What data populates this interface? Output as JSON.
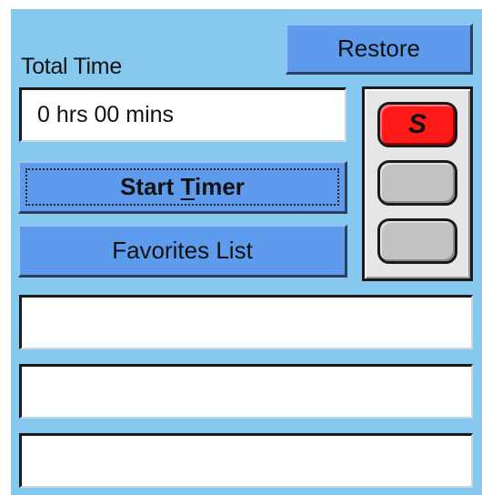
{
  "header": {
    "total_time_label": "Total Time",
    "restore_label": "Restore"
  },
  "timer": {
    "total_time_value": "0 hrs 00 mins",
    "start_label_prefix": "Start ",
    "start_label_mnemonic": "T",
    "start_label_suffix": "imer",
    "favorites_label": "Favorites List"
  },
  "slots": [
    {
      "label": "S",
      "state": "active",
      "color": "#ff1a1a"
    },
    {
      "label": "",
      "state": "empty",
      "color": "#c2c2c2"
    },
    {
      "label": "",
      "state": "empty",
      "color": "#c2c2c2"
    }
  ],
  "entries": [
    "",
    "",
    ""
  ],
  "colors": {
    "panel_background": "#86c8ee",
    "button": "#5f9bec",
    "field": "#ffffff"
  }
}
